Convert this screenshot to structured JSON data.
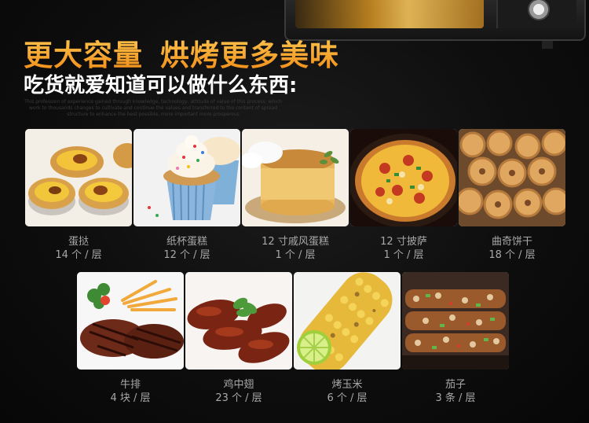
{
  "headline_part1": "更大容量",
  "headline_part2": "烘烤更多美味",
  "subheadline": "吃货就爱知道可以做什么东西:",
  "fine_print": "This profession of experience gained through knowledge, technology, attitude of value of this process; which work to thousands changes to cultivate and continue the values and transferred to the content of spread structure to enhance the best possible, more important more prosperous",
  "items": [
    {
      "name": "蛋挞",
      "quantity": "14 个 / 层",
      "icon": "egg-tart"
    },
    {
      "name": "纸杯蛋糕",
      "quantity": "12 个 / 层",
      "icon": "cupcake"
    },
    {
      "name": "12 寸戚风蛋糕",
      "quantity": "1 个 / 层",
      "icon": "chiffon-cake"
    },
    {
      "name": "12 寸披萨",
      "quantity": "1 个 / 层",
      "icon": "pizza"
    },
    {
      "name": "曲奇饼干",
      "quantity": "18 个 / 层",
      "icon": "cookies"
    },
    {
      "name": "牛排",
      "quantity": "4 块 / 层",
      "icon": "steak"
    },
    {
      "name": "鸡中翅",
      "quantity": "23 个 / 层",
      "icon": "chicken-wings"
    },
    {
      "name": "烤玉米",
      "quantity": "6 个 / 层",
      "icon": "grilled-corn"
    },
    {
      "name": "茄子",
      "quantity": "3 条 / 层",
      "icon": "eggplant"
    }
  ]
}
